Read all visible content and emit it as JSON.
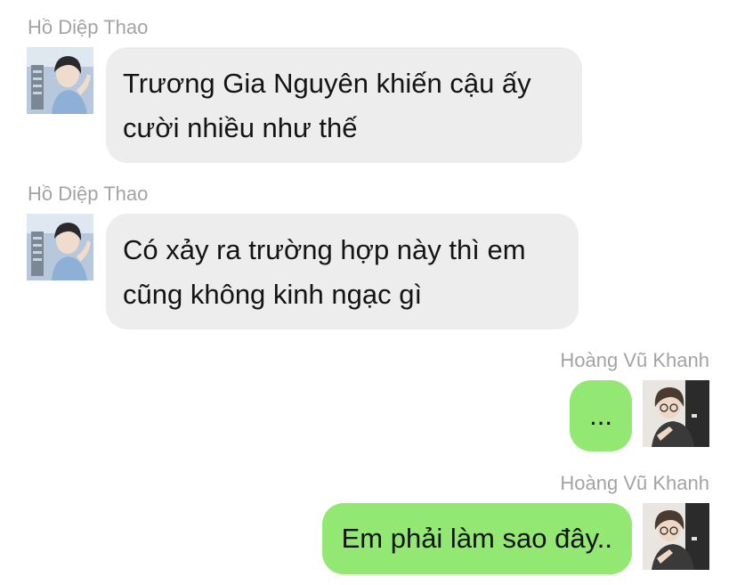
{
  "chat": {
    "messages": [
      {
        "sender": "Hồ Diệp Thao",
        "direction": "incoming",
        "lines": [
          "Trương Gia Nguyên khiến cậu ấy",
          "cười nhiều như thế"
        ]
      },
      {
        "sender": "Hồ Diệp Thao",
        "direction": "incoming",
        "lines": [
          "Có xảy ra trường hợp này thì em",
          "cũng không kinh ngạc gì"
        ]
      },
      {
        "sender": "Hoàng Vũ Khanh",
        "direction": "outgoing",
        "lines": [
          "..."
        ]
      },
      {
        "sender": "Hoàng Vũ Khanh",
        "direction": "outgoing",
        "lines": [
          "Em phải làm sao đây.."
        ]
      }
    ]
  },
  "colors": {
    "incoming_bubble": "#ededee",
    "outgoing_bubble": "#93e874",
    "sender_name": "#a3a3a3",
    "message_text": "#141414"
  }
}
